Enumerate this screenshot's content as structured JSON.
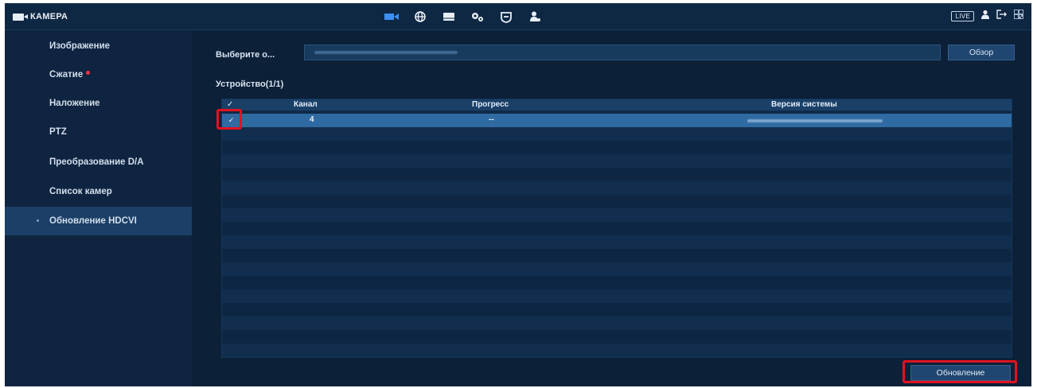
{
  "topbar": {
    "title": "КАМЕРА",
    "live_label": "LIVE",
    "icons": [
      "camera-icon",
      "network-icon",
      "storage-icon",
      "system-settings-icon",
      "security-icon",
      "account-icon"
    ]
  },
  "sidebar": {
    "items": [
      {
        "label": "Изображение"
      },
      {
        "label": "Сжатие"
      },
      {
        "label": "Наложение"
      },
      {
        "label": "PTZ"
      },
      {
        "label": "Преобразование D/A"
      },
      {
        "label": "Список камер"
      },
      {
        "label": "Обновление HDCVI"
      }
    ],
    "active_index": 6
  },
  "main": {
    "path_label": "Выберите о...",
    "browse_label": "Обзор",
    "devices_title": "Устройство(1/1)",
    "table": {
      "headers": {
        "check": "✓",
        "channel": "Канал",
        "progress": "Прогресс",
        "version": "Версия системы"
      },
      "rows": [
        {
          "checked": "✓",
          "channel": "4",
          "progress": "--"
        }
      ]
    },
    "update_label": "Обновление"
  },
  "colors": {
    "background": "#0c2038",
    "sidebar": "#0e2440",
    "selected_row": "#2f6aa2",
    "highlight": "#e2121f",
    "alert_dot": "#ff2f3e"
  }
}
